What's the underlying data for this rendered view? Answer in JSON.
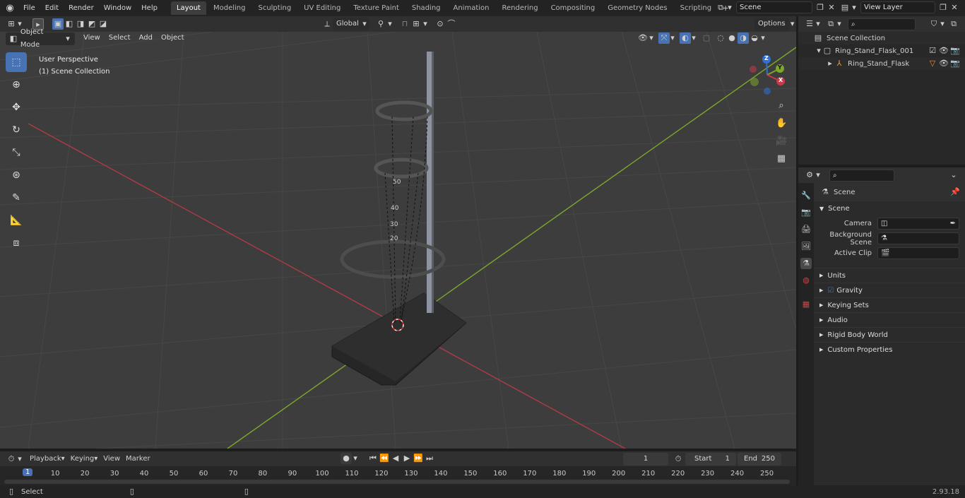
{
  "menus": [
    "File",
    "Edit",
    "Render",
    "Window",
    "Help"
  ],
  "workspaces": [
    "Layout",
    "Modeling",
    "Sculpting",
    "UV Editing",
    "Texture Paint",
    "Shading",
    "Animation",
    "Rendering",
    "Compositing",
    "Geometry Nodes",
    "Scripting"
  ],
  "active_workspace": "Layout",
  "add_workspace": "+",
  "scene_name": "Scene",
  "view_layer": "View Layer",
  "viewport": {
    "mode": "Object Mode",
    "menus": [
      "View",
      "Select",
      "Add",
      "Object"
    ],
    "transform": "Global",
    "options": "Options",
    "perspective": "User Perspective",
    "collection": "(1) Scene Collection",
    "gizmo": {
      "x": "X",
      "y": "Y",
      "z": "Z"
    },
    "scale_labels": [
      "50",
      "40",
      "30",
      "20"
    ]
  },
  "outliner": {
    "root": "Scene Collection",
    "items": [
      {
        "label": "Ring_Stand_Flask_001",
        "level": 1
      },
      {
        "label": "Ring_Stand_Flask",
        "level": 2
      }
    ]
  },
  "properties": {
    "breadcrumb": "Scene",
    "panel": "Scene",
    "fields": [
      {
        "label": "Camera"
      },
      {
        "label": "Background Scene"
      },
      {
        "label": "Active Clip"
      }
    ],
    "sections": [
      "Units",
      "Gravity",
      "Keying Sets",
      "Audio",
      "Rigid Body World",
      "Custom Properties"
    ]
  },
  "timeline": {
    "menus": [
      "Playback",
      "Keying",
      "View",
      "Marker"
    ],
    "current_frame": "1",
    "start_label": "Start",
    "start": "1",
    "end_label": "End",
    "end": "250",
    "ticks": [
      "1",
      "10",
      "20",
      "30",
      "40",
      "50",
      "60",
      "70",
      "80",
      "90",
      "100",
      "110",
      "120",
      "130",
      "140",
      "150",
      "160",
      "170",
      "180",
      "190",
      "200",
      "210",
      "220",
      "230",
      "240",
      "250"
    ]
  },
  "status": {
    "left": "Select",
    "version": "2.93.18"
  },
  "colors": {
    "accent": "#4772b3",
    "x_axis": "#b03a48",
    "y_axis": "#7ca72b",
    "header": "#303030"
  }
}
